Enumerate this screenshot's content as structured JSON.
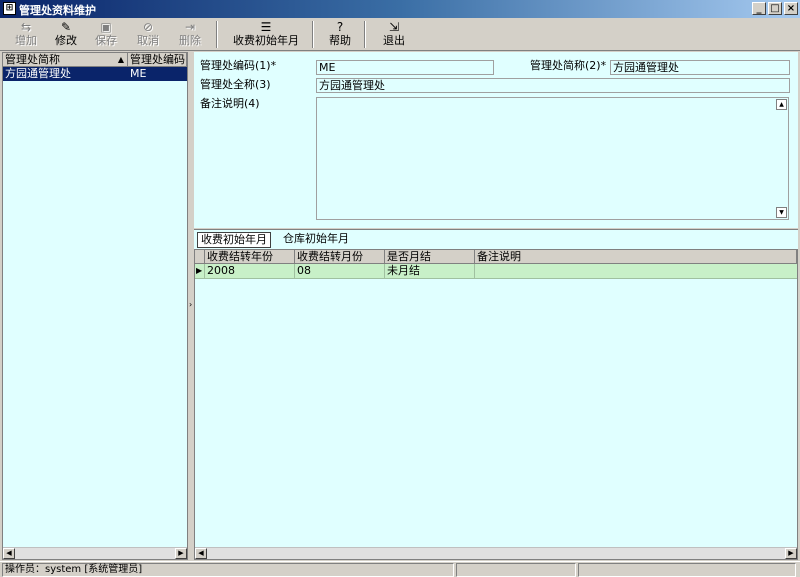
{
  "window": {
    "title": "管理处资料维护",
    "min": "_",
    "max": "□",
    "close": "×"
  },
  "toolbar": {
    "add": "增加",
    "edit": "修改",
    "save": "保存",
    "cancel": "取消",
    "delete": "删除",
    "start_month": "收费初始年月",
    "help": "帮助",
    "exit": "退出"
  },
  "left_list": {
    "columns": [
      "管理处简称",
      "管理处编码"
    ],
    "rows": [
      {
        "name": "方园通管理处",
        "code": "ME"
      }
    ]
  },
  "form": {
    "code_label": "管理处编码(1)*",
    "code_value": "ME",
    "short_label": "管理处简称(2)*",
    "short_value": "方园通管理处",
    "full_label": "管理处全称(3)",
    "full_value": "方园通管理处",
    "note_label": "备注说明(4)",
    "note_value": ""
  },
  "tabs": [
    "收费初始年月",
    "仓库初始年月"
  ],
  "grid": {
    "columns": [
      "收费结转年份",
      "收费结转月份",
      "是否月结",
      "备注说明"
    ],
    "rows": [
      {
        "year": "2008",
        "month": "08",
        "closed": "未月结",
        "note": ""
      }
    ]
  },
  "status": {
    "operator": "操作员：system [系统管理员]"
  }
}
